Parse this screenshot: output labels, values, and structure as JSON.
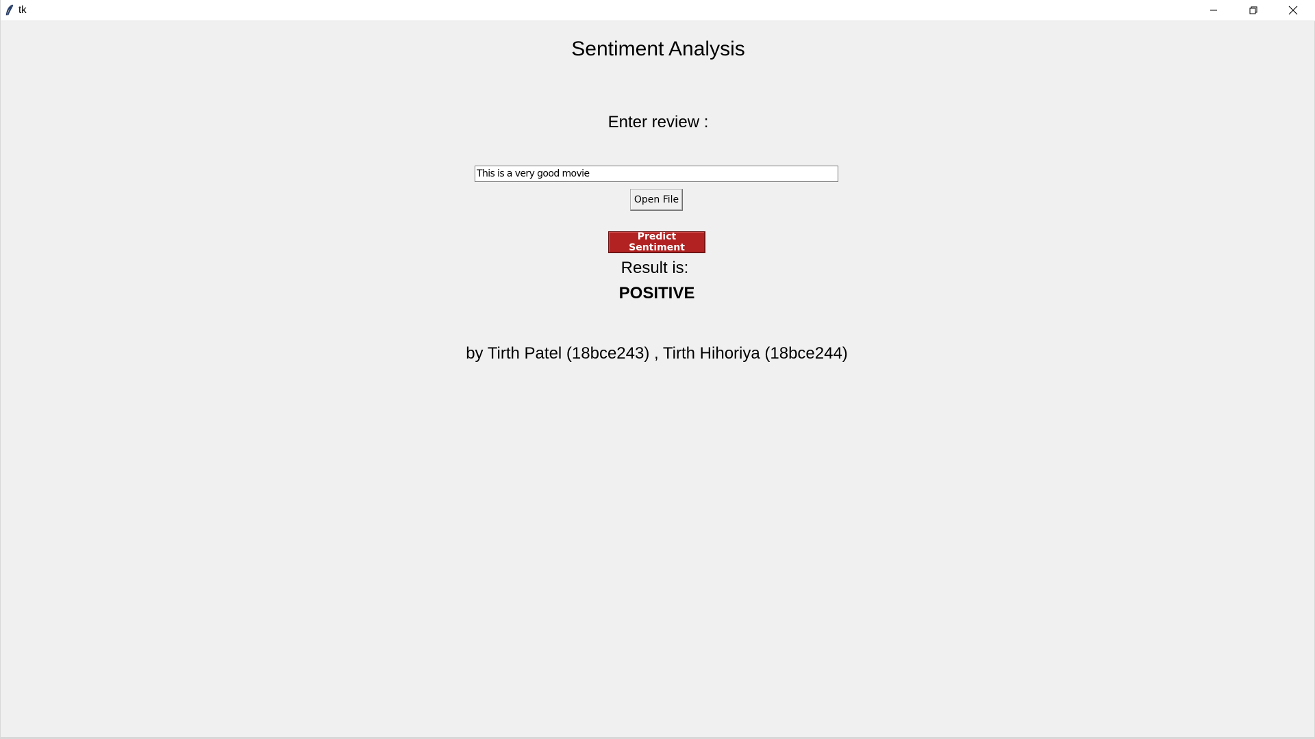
{
  "window": {
    "title": "tk",
    "icon": "tk-feather-icon",
    "controls": {
      "minimize_icon": "minimize-icon",
      "maximize_icon": "restore-icon",
      "close_icon": "close-icon"
    }
  },
  "app": {
    "heading": "Sentiment Analysis",
    "enter_label": "Enter review :",
    "review_value": "This is a very good movie",
    "open_file_label": "Open File",
    "predict_label": "Predict Sentiment",
    "result_label": "Result is:",
    "result_value": "POSITIVE",
    "credits": "by Tirth Patel (18bce243) , Tirth Hihoriya (18bce244)"
  },
  "colors": {
    "background": "#f0f0f0",
    "predict_button": "#b22222",
    "predict_text": "#ffffff"
  }
}
